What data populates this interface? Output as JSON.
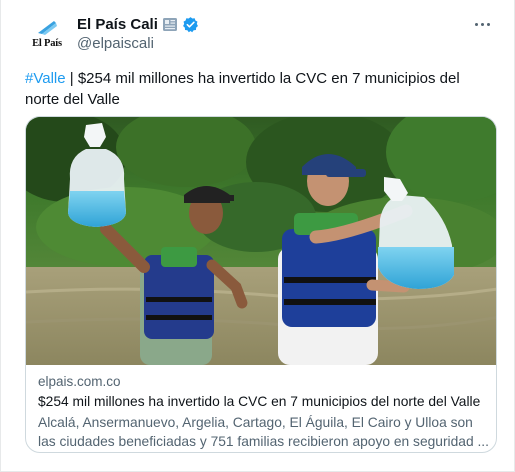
{
  "account": {
    "display_name": "El País Cali",
    "handle": "@elpaiscali",
    "logo_text": "El País"
  },
  "tweet": {
    "hashtag": "#Valle",
    "body": " | $254 mil millones ha invertido la CVC en 7 municipios del norte del Valle"
  },
  "link_card": {
    "domain": "elpais.com.co",
    "title": "$254 mil millones ha invertido la CVC en 7 municipios del norte del Valle",
    "description": "Alcalá, Ansermanuevo, Argelia, Cartago, El Águila, El Cairo y Ulloa son las ciudades beneficiadas y 751 familias recibieron apoyo en seguridad ..."
  },
  "colors": {
    "accent": "#1d9bf0",
    "text": "#0f1419",
    "muted": "#536471",
    "border": "#cfd9de"
  }
}
